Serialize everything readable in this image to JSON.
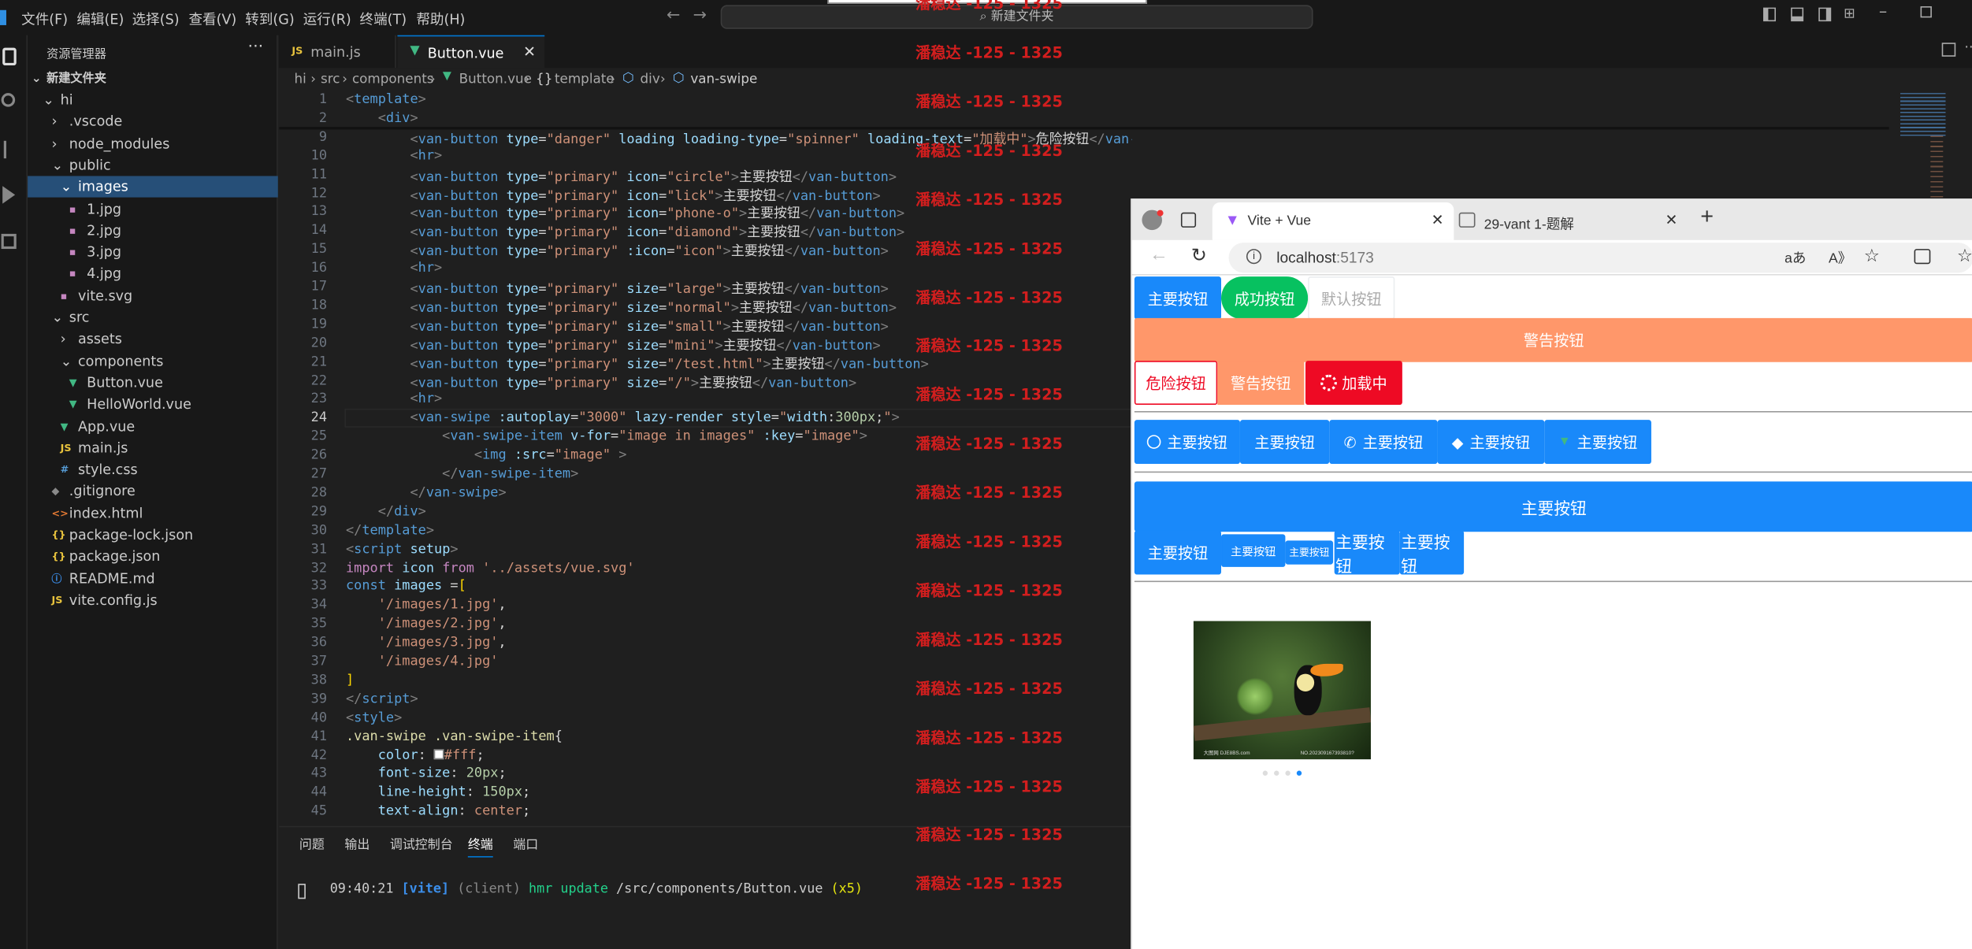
{
  "menu": [
    "文件(F)",
    "编辑(E)",
    "选择(S)",
    "查看(V)",
    "转到(G)",
    "运行(R)",
    "终端(T)",
    "帮助(H)"
  ],
  "search_text": "新建文件夹",
  "watermark": "潘稳达 -125 - 1325",
  "explorer": {
    "title": "资源管理器",
    "folder": "新建文件夹",
    "items": [
      {
        "label": "hi",
        "depth": 1,
        "type": "folder-open"
      },
      {
        "label": ".vscode",
        "depth": 2,
        "type": "folder"
      },
      {
        "label": "node_modules",
        "depth": 2,
        "type": "folder"
      },
      {
        "label": "public",
        "depth": 2,
        "type": "folder-open"
      },
      {
        "label": "images",
        "depth": 3,
        "type": "folder-open",
        "selected": true
      },
      {
        "label": "1.jpg",
        "depth": 4,
        "type": "image"
      },
      {
        "label": "2.jpg",
        "depth": 4,
        "type": "image"
      },
      {
        "label": "3.jpg",
        "depth": 4,
        "type": "image"
      },
      {
        "label": "4.jpg",
        "depth": 4,
        "type": "image"
      },
      {
        "label": "vite.svg",
        "depth": 3,
        "type": "image"
      },
      {
        "label": "src",
        "depth": 2,
        "type": "folder-open"
      },
      {
        "label": "assets",
        "depth": 3,
        "type": "folder"
      },
      {
        "label": "components",
        "depth": 3,
        "type": "folder-open"
      },
      {
        "label": "Button.vue",
        "depth": 4,
        "type": "vue"
      },
      {
        "label": "HelloWorld.vue",
        "depth": 4,
        "type": "vue"
      },
      {
        "label": "App.vue",
        "depth": 3,
        "type": "vue"
      },
      {
        "label": "main.js",
        "depth": 3,
        "type": "js"
      },
      {
        "label": "style.css",
        "depth": 3,
        "type": "css"
      },
      {
        "label": ".gitignore",
        "depth": 2,
        "type": "git"
      },
      {
        "label": "index.html",
        "depth": 2,
        "type": "html"
      },
      {
        "label": "package-lock.json",
        "depth": 2,
        "type": "json"
      },
      {
        "label": "package.json",
        "depth": 2,
        "type": "json"
      },
      {
        "label": "README.md",
        "depth": 2,
        "type": "md"
      },
      {
        "label": "vite.config.js",
        "depth": 2,
        "type": "js"
      }
    ]
  },
  "tabs": [
    {
      "label": "main.js",
      "badge": "JS"
    },
    {
      "label": "Button.vue",
      "active": true
    }
  ],
  "breadcrumb": [
    "hi",
    "src",
    "components",
    "Button.vue",
    "template",
    "div",
    "van-swipe"
  ],
  "code_lines": [
    {
      "n": "1",
      "html": "<span class=p>&lt;</span><span class=t>template</span><span class=p>&gt;</span>"
    },
    {
      "n": "2",
      "html": "    <span class=p>&lt;</span><span class=t>div</span><span class=p>&gt;</span>"
    },
    {
      "n": "9",
      "html": "        <span class=p>&lt;</span><span class=t>van-button</span> <span class=a>type</span>=<span class=s>\"danger\"</span> <span class=a>loading</span> <span class=a>loading-type</span>=<span class=s>\"spinner\"</span> <span class=a>loading-text</span>=<span class=s>\"加载中\"</span><span class=p>&gt;</span>危险按钮<span class=p>&lt;/</span><span class=t>van-button</span><span class=p>&gt;</span>"
    },
    {
      "n": "10",
      "html": "        <span class=p>&lt;</span><span class=t>hr</span><span class=p>&gt;</span>"
    },
    {
      "n": "11",
      "html": "        <span class=p>&lt;</span><span class=t>van-button</span> <span class=a>type</span>=<span class=s>\"primary\"</span> <span class=a>icon</span>=<span class=s>\"circle\"</span><span class=p>&gt;</span>主要按钮<span class=p>&lt;/</span><span class=t>van-button</span><span class=p>&gt;</span>"
    },
    {
      "n": "12",
      "html": "        <span class=p>&lt;</span><span class=t>van-button</span> <span class=a>type</span>=<span class=s>\"primary\"</span> <span class=a>icon</span>=<span class=s>\"lick\"</span><span class=p>&gt;</span>主要按钮<span class=p>&lt;/</span><span class=t>van-button</span><span class=p>&gt;</span>"
    },
    {
      "n": "13",
      "html": "        <span class=p>&lt;</span><span class=t>van-button</span> <span class=a>type</span>=<span class=s>\"primary\"</span> <span class=a>icon</span>=<span class=s>\"phone-o\"</span><span class=p>&gt;</span>主要按钮<span class=p>&lt;/</span><span class=t>van-button</span><span class=p>&gt;</span>"
    },
    {
      "n": "14",
      "html": "        <span class=p>&lt;</span><span class=t>van-button</span> <span class=a>type</span>=<span class=s>\"primary\"</span> <span class=a>icon</span>=<span class=s>\"diamond\"</span><span class=p>&gt;</span>主要按钮<span class=p>&lt;/</span><span class=t>van-button</span><span class=p>&gt;</span>"
    },
    {
      "n": "15",
      "html": "        <span class=p>&lt;</span><span class=t>van-button</span> <span class=a>type</span>=<span class=s>\"primary\"</span> <span class=a>:icon</span>=<span class=s>\"icon\"</span><span class=p>&gt;</span>主要按钮<span class=p>&lt;/</span><span class=t>van-button</span><span class=p>&gt;</span>"
    },
    {
      "n": "16",
      "html": "        <span class=p>&lt;</span><span class=t>hr</span><span class=p>&gt;</span>"
    },
    {
      "n": "17",
      "html": "        <span class=p>&lt;</span><span class=t>van-button</span> <span class=a>type</span>=<span class=s>\"primary\"</span> <span class=a>size</span>=<span class=s>\"large\"</span><span class=p>&gt;</span>主要按钮<span class=p>&lt;/</span><span class=t>van-button</span><span class=p>&gt;</span>"
    },
    {
      "n": "18",
      "html": "        <span class=p>&lt;</span><span class=t>van-button</span> <span class=a>type</span>=<span class=s>\"primary\"</span> <span class=a>size</span>=<span class=s>\"normal\"</span><span class=p>&gt;</span>主要按钮<span class=p>&lt;/</span><span class=t>van-button</span><span class=p>&gt;</span>"
    },
    {
      "n": "19",
      "html": "        <span class=p>&lt;</span><span class=t>van-button</span> <span class=a>type</span>=<span class=s>\"primary\"</span> <span class=a>size</span>=<span class=s>\"small\"</span><span class=p>&gt;</span>主要按钮<span class=p>&lt;/</span><span class=t>van-button</span><span class=p>&gt;</span>"
    },
    {
      "n": "20",
      "html": "        <span class=p>&lt;</span><span class=t>van-button</span> <span class=a>type</span>=<span class=s>\"primary\"</span> <span class=a>size</span>=<span class=s>\"mini\"</span><span class=p>&gt;</span>主要按钮<span class=p>&lt;/</span><span class=t>van-button</span><span class=p>&gt;</span>"
    },
    {
      "n": "21",
      "html": "        <span class=p>&lt;</span><span class=t>van-button</span> <span class=a>type</span>=<span class=s>\"primary\"</span> <span class=a>size</span>=<span class=s>\"/test.html\"</span><span class=p>&gt;</span>主要按钮<span class=p>&lt;/</span><span class=t>van-button</span><span class=p>&gt;</span>"
    },
    {
      "n": "22",
      "html": "        <span class=p>&lt;</span><span class=t>van-button</span> <span class=a>type</span>=<span class=s>\"primary\"</span> <span class=a>size</span>=<span class=s>\"/\"</span><span class=p>&gt;</span>主要按钮<span class=p>&lt;/</span><span class=t>van-button</span><span class=p>&gt;</span>"
    },
    {
      "n": "23",
      "html": "        <span class=p>&lt;</span><span class=t>hr</span><span class=p>&gt;</span>"
    },
    {
      "n": "24",
      "html": "        <span class=p>&lt;</span><span class=t>van-swipe</span> <span class=a>:autoplay</span>=<span class=s>\"3000\"</span> <span class=a>lazy-render</span> <span class=a>style</span>=<span class=s>\"</span><span class=a>width</span>:<span class=n>300px</span>;<span class=s>\"</span><span class=p>&gt;</span>"
    },
    {
      "n": "25",
      "html": "            <span class=p>&lt;</span><span class=t>van-swipe-item</span> <span class=a>v-for</span>=<span class=s>\"image in images\"</span> <span class=a>:key</span>=<span class=s>\"image\"</span><span class=p>&gt;</span>"
    },
    {
      "n": "26",
      "html": "                <span class=p>&lt;</span><span class=t>img</span> <span class=a>:src</span>=<span class=s>\"image\"</span> <span class=p>&gt;</span>"
    },
    {
      "n": "27",
      "html": "            <span class=p>&lt;/</span><span class=t>van-swipe-item</span><span class=p>&gt;</span>"
    },
    {
      "n": "28",
      "html": "        <span class=p>&lt;/</span><span class=t>van-swipe</span><span class=p>&gt;</span>"
    },
    {
      "n": "29",
      "html": "    <span class=p>&lt;/</span><span class=t>div</span><span class=p>&gt;</span>"
    },
    {
      "n": "30",
      "html": "<span class=p>&lt;/</span><span class=t>template</span><span class=p>&gt;</span>"
    },
    {
      "n": "31",
      "html": "<span class=p>&lt;</span><span class=t>script</span> <span class=a>setup</span><span class=p>&gt;</span>"
    },
    {
      "n": "32",
      "html": "<span class=k>import</span> <span class=a>icon</span> <span class=k>from</span> <span class=s>'../assets/vue.svg'</span>"
    },
    {
      "n": "33",
      "html": "<span class=t>const</span> <span class=a>images</span> =<span class=g>[</span>"
    },
    {
      "n": "34",
      "html": "    <span class=s>'/images/1.jpg'</span>,"
    },
    {
      "n": "35",
      "html": "    <span class=s>'/images/2.jpg'</span>,"
    },
    {
      "n": "36",
      "html": "    <span class=s>'/images/3.jpg'</span>,"
    },
    {
      "n": "37",
      "html": "    <span class=s>'/images/4.jpg'</span>"
    },
    {
      "n": "38",
      "html": "<span class=g>]</span>"
    },
    {
      "n": "39",
      "html": "<span class=p>&lt;/</span><span class=t>script</span><span class=p>&gt;</span>"
    },
    {
      "n": "40",
      "html": "<span class=p>&lt;</span><span class=t>style</span><span class=p>&gt;</span>"
    },
    {
      "n": "41",
      "html": "<span class=y>.van-swipe</span> <span class=y>.van-swipe-item</span>{"
    },
    {
      "n": "42",
      "html": "    <span class=a>color</span>: <span style=\"display:inline-block;width:8px;height:8px;background:#fff;border:1px solid #888\"></span><span class=s>#fff</span>;"
    },
    {
      "n": "43",
      "html": "    <span class=a>font-size</span>: <span class=n>20px</span>;"
    },
    {
      "n": "44",
      "html": "    <span class=a>line-height</span>: <span class=n>150px</span>;"
    },
    {
      "n": "45",
      "html": "    <span class=a>text-align</span>: <span class=s>center</span>;"
    }
  ],
  "panel": {
    "tabs": [
      "问题",
      "输出",
      "调试控制台",
      "终端",
      "端口"
    ],
    "active": "终端",
    "line": {
      "time": "09:40:21",
      "tag": "[vite]",
      "client": "(client)",
      "msg": "hmr update",
      "path": "/src/components/Button.vue",
      "count": "(x5)"
    }
  },
  "browser": {
    "tabs": [
      {
        "label": "Vite + Vue",
        "active": true
      },
      {
        "label": "29-vant 1-题解"
      }
    ],
    "url_host": "localhost",
    "url_port": ":5173",
    "row1": [
      "主要按钮",
      "成功按钮",
      "默认按钮"
    ],
    "warning_block": "警告按钮",
    "row3": [
      "危险按钮",
      "警告按钮",
      "加载中"
    ],
    "icon_row": [
      "主要按钮",
      "主要按钮",
      "主要按钮",
      "主要按钮",
      "主要按钮"
    ],
    "large": "主要按钮",
    "sizes": [
      "主要按钮",
      "主要按钮",
      "主要按钮",
      "主要按钮",
      "主要按钮"
    ],
    "swipe": {
      "count": 4,
      "active": 4,
      "image_caption_left": "大图网 DJE8BS.com",
      "image_caption_right": "NO.202309167393810?"
    }
  },
  "colors": {
    "primary": "#1989fa",
    "success": "#07c160",
    "warning": "#ff976a",
    "danger": "#ee0a24",
    "watermark": "#d21e1e"
  }
}
